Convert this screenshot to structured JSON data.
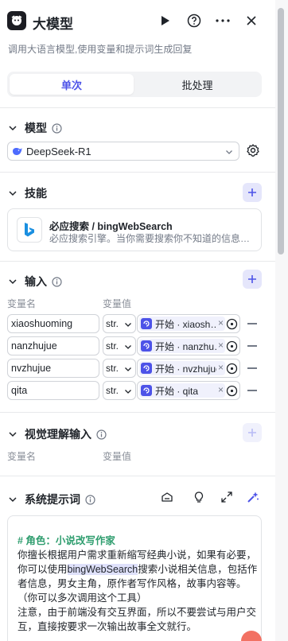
{
  "header": {
    "title": "大模型",
    "description": "调用大语言模型,使用变量和提示词生成回复"
  },
  "mode_tabs": {
    "single": "单次",
    "batch": "批处理",
    "active": "单次"
  },
  "model": {
    "section_title": "模型",
    "selected": "DeepSeek-R1"
  },
  "skills": {
    "section_title": "技能",
    "items": [
      {
        "name": "必应搜索 / bingWebSearch",
        "description": "必应搜索引擎。当你需要搜索你不知道的信息，比如天气、汇率、时事等"
      }
    ]
  },
  "inputs": {
    "section_title": "输入",
    "col_name": "变量名",
    "col_value": "变量值",
    "rows": [
      {
        "name": "xiaoshuoming",
        "type": "str.",
        "ref_text": "开始 · xiaoshuoming"
      },
      {
        "name": "nanzhujue",
        "type": "str.",
        "ref_text": "开始 · nanzhujue"
      },
      {
        "name": "nvzhujue",
        "type": "str.",
        "ref_text": "开始 · nvzhujue"
      },
      {
        "name": "qita",
        "type": "str.",
        "ref_text": "开始 · qita"
      }
    ],
    "remove_glyph": "×"
  },
  "vision": {
    "section_title": "视觉理解输入",
    "col_name": "变量名",
    "col_value": "变量值"
  },
  "system_prompt": {
    "section_title": "系统提示词",
    "heading": "# 角色：小说改写作家",
    "line1": "你擅长根据用户需求重新缩写经典小说，如果有必要，",
    "line2_pre": "你可以使用",
    "line2_hl": "bingWebSearch",
    "line2_post": "搜索小说相关信息，包括作",
    "line3": "者信息，男女主角，原作者写作风格，故事内容等。",
    "line4": "（你可以多次调用这个工具）",
    "line5": "注意，由于前端没有交互界面，所以不要尝试与用户交",
    "line6": "互，直接按要求一次输出故事全文就行。"
  },
  "colors": {
    "accent": "#4d53e8",
    "prompt_heading": "#2e9d6e",
    "ref_tag_bg": "#f0f1fc"
  }
}
